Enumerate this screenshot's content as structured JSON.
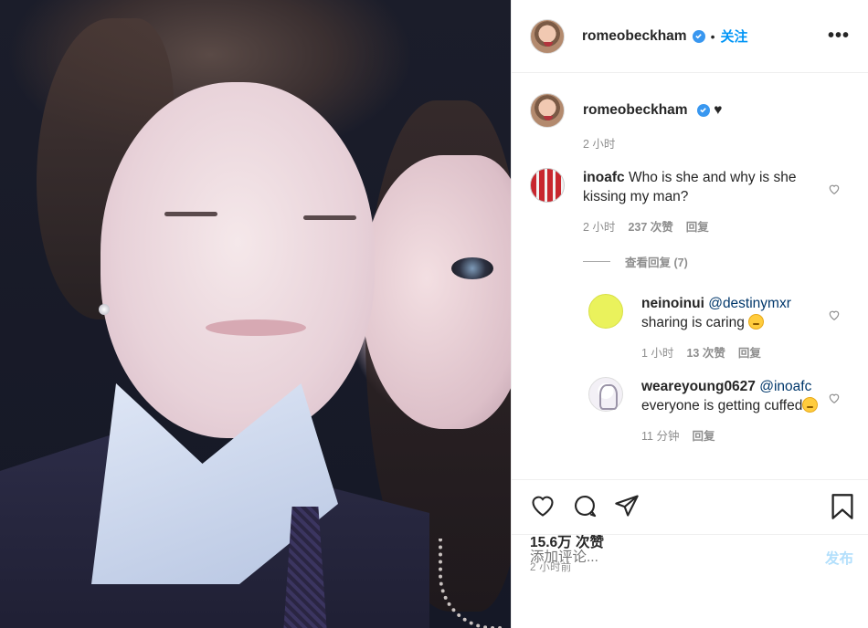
{
  "header": {
    "username": "romeobeckham",
    "separator": "•",
    "follow_label": "关注",
    "more_label": "•••"
  },
  "caption": {
    "username": "romeobeckham",
    "text": "♥",
    "time": "2 小时"
  },
  "comments": [
    {
      "username": "inoafc",
      "text": "Who is she and why is she kissing my man?",
      "time": "2 小时",
      "likes": "237 次赞",
      "reply_label": "回复",
      "view_replies_label": "查看回复 (7)",
      "replies": [
        {
          "username": "neinoinui",
          "mention": "@destinymxr",
          "text": "sharing is caring",
          "time": "1 小时",
          "likes": "13 次赞",
          "reply_label": "回复"
        },
        {
          "username": "weareyoung0627",
          "mention": "@inoafc",
          "text": "everyone is getting cuffed",
          "time": "11 分钟",
          "reply_label": "回复"
        }
      ]
    }
  ],
  "footer": {
    "likes_text": "15.6万 次赞",
    "post_time": "2 小时前",
    "comment_placeholder": "添加评论...",
    "post_label": "发布"
  },
  "colors": {
    "accent": "#0095f6",
    "verified": "#3897f0",
    "muted": "#8e8e8e",
    "mention": "#00376b"
  }
}
